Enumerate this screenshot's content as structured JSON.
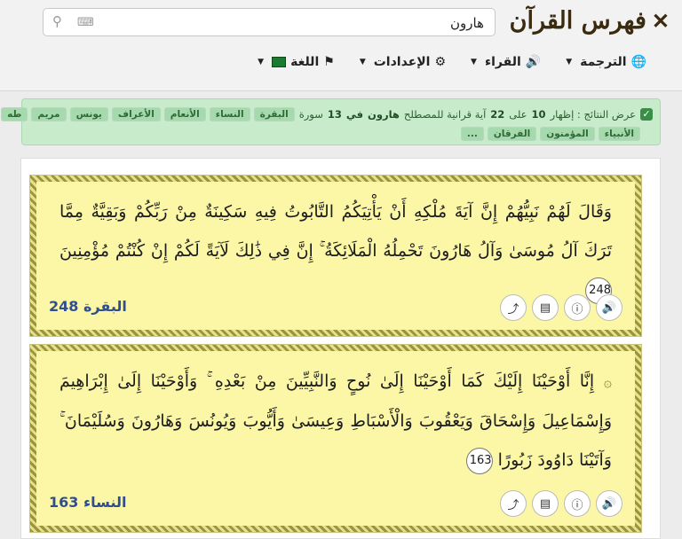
{
  "header": {
    "logo_text": "فهرس القرآن",
    "search": {
      "value": "هارون",
      "placeholder": ""
    },
    "nav": [
      {
        "label": "الترجمة",
        "icon": "globe-icon"
      },
      {
        "label": "القراء",
        "icon": "speaker-icon"
      },
      {
        "label": "الإعدادات",
        "icon": "gear-icon"
      },
      {
        "label": "اللغة",
        "icon": "flag-icon"
      }
    ]
  },
  "banner": {
    "prefix": "عرض النتائج : إظهار",
    "shown": "10",
    "on": "على",
    "total_ayat": "22",
    "ayat_label": "آية قرانية للمصطلح",
    "term": "هارون",
    "in": "في",
    "sura_count": "13",
    "sura_label": "سورة",
    "suras_row1": [
      "البقرة",
      "النساء",
      "الأنعام",
      "الأعراف",
      "يونس",
      "مريم",
      "طه"
    ],
    "suras_row2": [
      "الأنبياء",
      "المؤمنون",
      "الفرقان",
      "..."
    ]
  },
  "verses": [
    {
      "text": "وَقَالَ لَهُمْ نَبِيُّهُمْ إِنَّ آيَةَ مُلْكِهِ أَنْ يَأْتِيَكُمُ التَّابُوتُ فِيهِ سَكِينَةٌ مِنْ رَبِّكُمْ وَبَقِيَّةٌ مِمَّا تَرَكَ آلُ مُوسَىٰ وَآلُ هَارُونَ تَحْمِلُهُ الْمَلَائِكَةُ ۚ إِنَّ فِي ذَٰلِكَ لَآيَةً لَكُمْ إِنْ كُنْتُمْ مُؤْمِنِينَ",
      "number": "248",
      "sura_ref": "البقرة 248"
    },
    {
      "text": "إِنَّا أَوْحَيْنَا إِلَيْكَ كَمَا أَوْحَيْنَا إِلَىٰ نُوحٍ وَالنَّبِيِّينَ مِنْ بَعْدِهِ ۚ وَأَوْحَيْنَا إِلَىٰ إِبْرَاهِيمَ وَإِسْمَاعِيلَ وَإِسْحَاقَ وَيَعْقُوبَ وَالْأَسْبَاطِ وَعِيسَىٰ وَأَيُّوبَ وَيُونُسَ وَهَارُونَ وَسُلَيْمَانَ ۚ وَآتَيْنَا دَاوُودَ زَبُورًا",
      "number": "163",
      "sura_ref": "النساء 163"
    }
  ]
}
